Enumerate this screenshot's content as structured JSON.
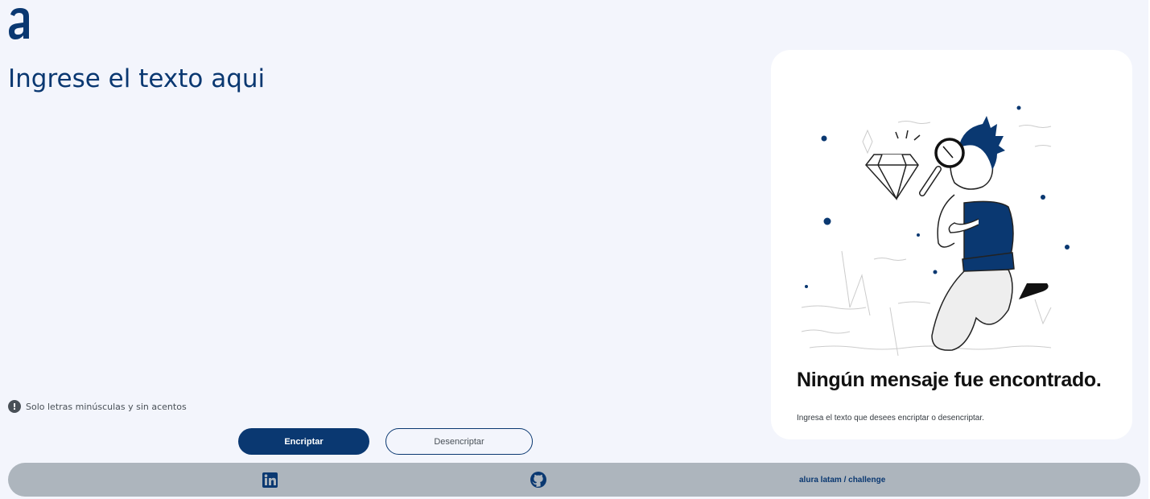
{
  "logo": {
    "name": "alura-logo",
    "color": "#0A3871"
  },
  "editor": {
    "placeholder": "Ingrese el texto aqui"
  },
  "hint": {
    "icon": "exclamation-icon",
    "text": "Solo letras minúsculas y sin acentos"
  },
  "actions": {
    "encrypt_label": "Encriptar",
    "decrypt_label": "Desencriptar"
  },
  "result_card": {
    "title": "Ningún mensaje fue encontrado.",
    "subtitle": "Ingresa el texto que desees encriptar o desencriptar."
  },
  "footer": {
    "linkedin_icon": "linkedin-icon",
    "github_icon": "github-icon",
    "text": "alura latam / challenge"
  },
  "colors": {
    "primary": "#0A3871",
    "background": "#F3F5FC",
    "footer": "#ADB5BD",
    "card": "#FFFFFF"
  }
}
